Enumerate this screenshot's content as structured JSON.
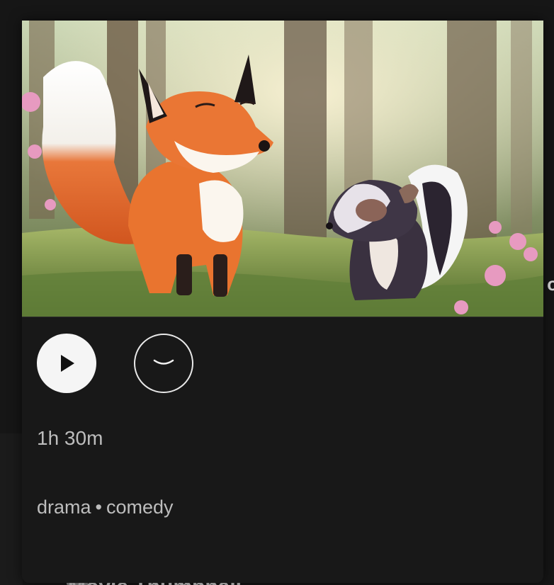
{
  "background": {
    "peek_text": "o",
    "bottom_title": "Movie Thumbnail"
  },
  "preview": {
    "image_icon": "fox-and-skunk-in-forest-illustration",
    "actions": {
      "play_icon": "play-icon",
      "more_icon": "chevron-down-icon"
    },
    "duration": "1h 30m",
    "genres": [
      "drama",
      "comedy"
    ],
    "genre_separator": "•"
  },
  "colors": {
    "page_bg": "#161616",
    "card_bg": "#181818",
    "meta_text": "#bdbdbd",
    "play_bg": "#f5f5f5"
  }
}
